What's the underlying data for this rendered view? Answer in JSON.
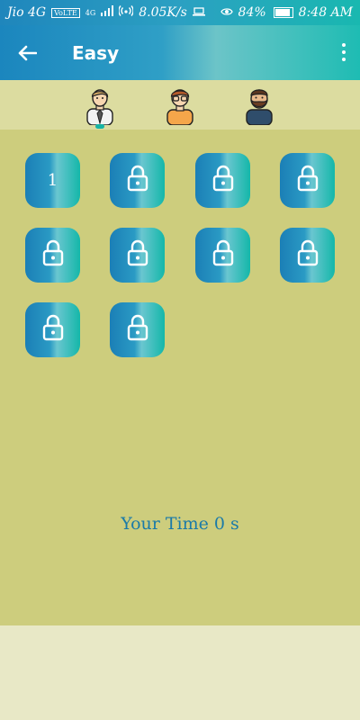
{
  "status": {
    "carrier": "Jio 4G",
    "volte": "VoLTE",
    "network": "4G",
    "speed": "8.05K/s",
    "battery": "84%",
    "time": "8:48 AM"
  },
  "appbar": {
    "title": "Easy",
    "back_icon": "arrow-left-icon",
    "menu_icon": "more-vert-icon"
  },
  "tabs": [
    {
      "name": "man-tie-avatar"
    },
    {
      "name": "man-glasses-avatar"
    },
    {
      "name": "man-beard-avatar"
    }
  ],
  "levels": [
    {
      "label": "1",
      "locked": false
    },
    {
      "label": "",
      "locked": true
    },
    {
      "label": "",
      "locked": true
    },
    {
      "label": "",
      "locked": true
    },
    {
      "label": "",
      "locked": true
    },
    {
      "label": "",
      "locked": true
    },
    {
      "label": "",
      "locked": true
    },
    {
      "label": "",
      "locked": true
    },
    {
      "label": "",
      "locked": true
    },
    {
      "label": "",
      "locked": true
    }
  ],
  "your_time": "Your Time 0 s",
  "colors": {
    "accent": "#1a7aa8",
    "bg": "#cdcd7d",
    "tabbar": "#dcdca0"
  }
}
